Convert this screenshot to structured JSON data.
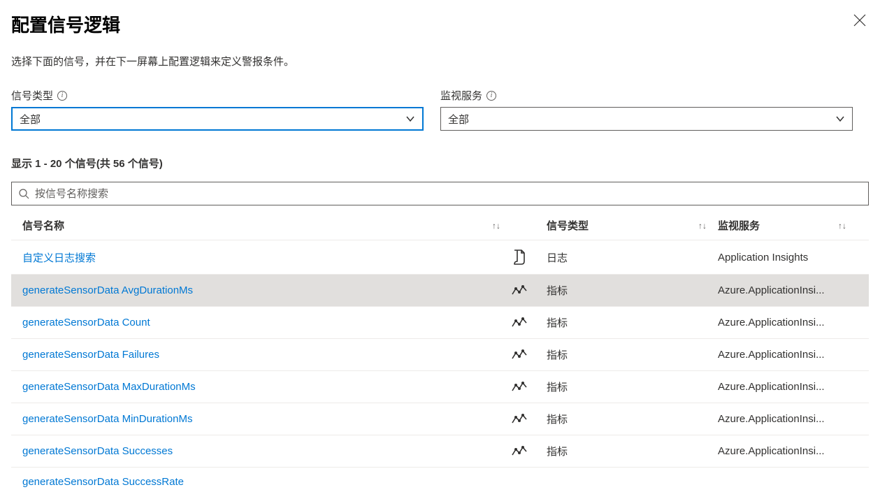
{
  "header": {
    "title": "配置信号逻辑"
  },
  "subtitle": "选择下面的信号，并在下一屏幕上配置逻辑来定义警报条件。",
  "filters": {
    "signal_type": {
      "label": "信号类型",
      "value": "全部"
    },
    "monitor_service": {
      "label": "监视服务",
      "value": "全部"
    }
  },
  "count_text": "显示 1 - 20 个信号(共 56 个信号)",
  "search": {
    "placeholder": "按信号名称搜索"
  },
  "columns": {
    "name": "信号名称",
    "type": "信号类型",
    "service": "监视服务"
  },
  "rows": [
    {
      "name": "自定义日志搜索",
      "icon": "log",
      "type": "日志",
      "service": "Application Insights",
      "highlighted": false
    },
    {
      "name": "generateSensorData AvgDurationMs",
      "icon": "metric",
      "type": "指标",
      "service": "Azure.ApplicationInsi...",
      "highlighted": true
    },
    {
      "name": "generateSensorData Count",
      "icon": "metric",
      "type": "指标",
      "service": "Azure.ApplicationInsi...",
      "highlighted": false
    },
    {
      "name": "generateSensorData Failures",
      "icon": "metric",
      "type": "指标",
      "service": "Azure.ApplicationInsi...",
      "highlighted": false
    },
    {
      "name": "generateSensorData MaxDurationMs",
      "icon": "metric",
      "type": "指标",
      "service": "Azure.ApplicationInsi...",
      "highlighted": false
    },
    {
      "name": "generateSensorData MinDurationMs",
      "icon": "metric",
      "type": "指标",
      "service": "Azure.ApplicationInsi...",
      "highlighted": false
    },
    {
      "name": "generateSensorData Successes",
      "icon": "metric",
      "type": "指标",
      "service": "Azure.ApplicationInsi...",
      "highlighted": false
    }
  ],
  "partial_row": "generateSensorData SuccessRate"
}
